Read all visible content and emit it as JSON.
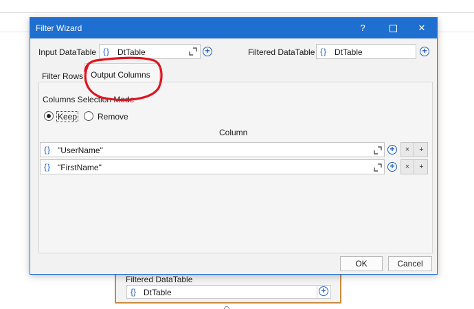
{
  "background": {
    "activity_label": "Filtered DataTable",
    "activity_value": "DtTable"
  },
  "dialog": {
    "title": "Filter Wizard",
    "help_label": "?",
    "close_label": "✕"
  },
  "input_datatable": {
    "label": "Input DataTable",
    "brace": "{}",
    "value": "DtTable"
  },
  "filtered_datatable": {
    "label": "Filtered DataTable",
    "brace": "{}",
    "value": "DtTable"
  },
  "tabs": [
    {
      "label": "Filter Rows",
      "active": false
    },
    {
      "label": "Output Columns",
      "active": true
    }
  ],
  "mode": {
    "title": "Columns Selection Mode",
    "options": [
      {
        "label": "Keep",
        "checked": true
      },
      {
        "label": "Remove",
        "checked": false
      }
    ]
  },
  "columns": {
    "header": "Column",
    "rows": [
      {
        "brace": "{}",
        "value": "\"UserName\""
      },
      {
        "brace": "{}",
        "value": "\"FirstName\""
      }
    ],
    "remove_label": "×",
    "add_label": "+"
  },
  "footer": {
    "ok_label": "OK",
    "cancel_label": "Cancel"
  },
  "colors": {
    "accent": "#1e6fd0",
    "annotation_red": "#e0141e",
    "activity_border": "#c98a3a"
  }
}
